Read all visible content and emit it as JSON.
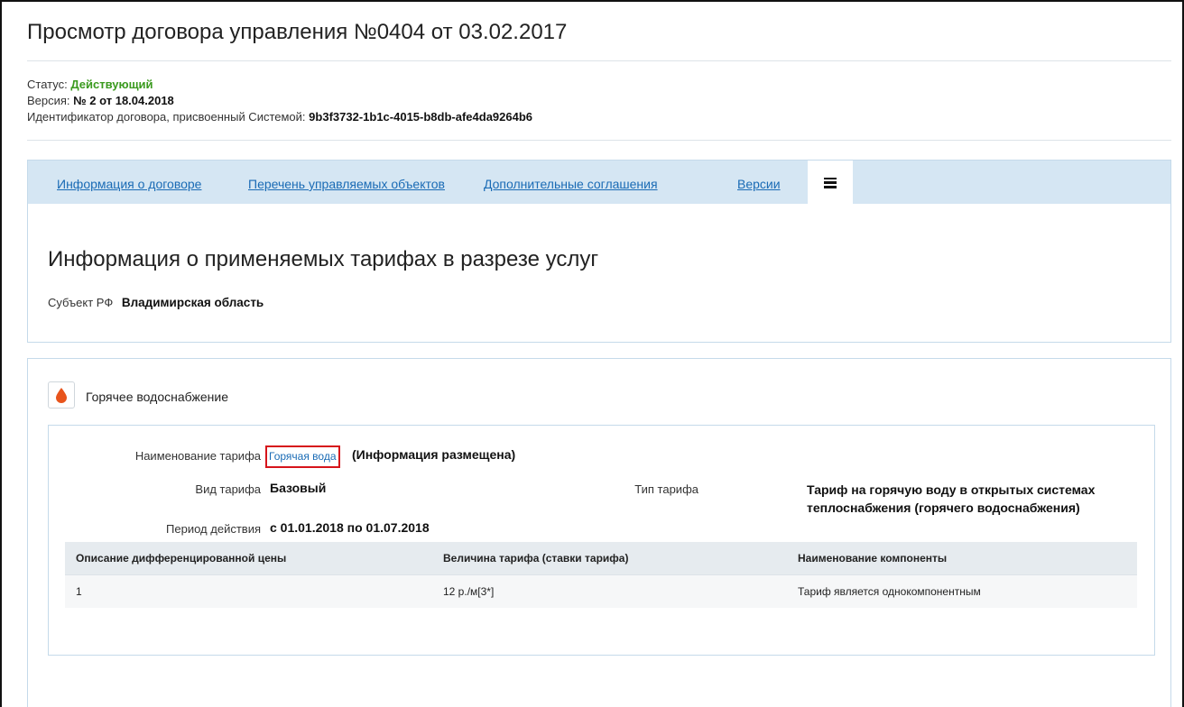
{
  "page": {
    "title": "Просмотр договора управления №0404 от 03.02.2017"
  },
  "meta": {
    "status_label": "Статус:",
    "status_value": "Действующий",
    "version_label": "Версия:",
    "version_value": "№ 2 от 18.04.2018",
    "id_label": "Идентификатор договора, присвоенный Системой:",
    "id_value": "9b3f3732-1b1c-4015-b8db-afe4da9264b6"
  },
  "tabs": [
    {
      "label": "Информация о договоре"
    },
    {
      "label": "Перечень управляемых объектов"
    },
    {
      "label": "Дополнительные соглашения"
    },
    {
      "label": "Версии"
    }
  ],
  "tariffs": {
    "section_title": "Информация о применяемых тарифах в разрезе услуг",
    "subject_label": "Субъект РФ",
    "subject_value": "Владимирская область"
  },
  "service": {
    "name": "Горячее водоснабжение",
    "icon": "water-drop-icon",
    "tariff_name_label": "Наименование тарифа",
    "tariff_name_link": "Горячая вода",
    "tariff_name_status": "(Информация размещена)",
    "tariff_kind_label": "Вид тарифа",
    "tariff_kind_value": "Базовый",
    "tariff_type_label": "Тип тарифа",
    "tariff_type_value_line1": "Тариф на горячую воду в открытых системах",
    "tariff_type_value_line2": "теплоснабжения (горячего водоснабжения)",
    "period_label": "Период действия",
    "period_value": "с 01.01.2018 по 01.07.2018",
    "table": {
      "headers": [
        "Описание дифференцированной цены",
        "Величина тарифа (ставки тарифа)",
        "Наименование компоненты"
      ],
      "rows": [
        [
          "1",
          "12 р./м[3*]",
          "Тариф является однокомпонентным"
        ]
      ]
    }
  },
  "colors": {
    "link": "#1a6bb5",
    "status_green": "#3a9a1e",
    "tab_bar": "#d5e6f3",
    "highlight_box": "#d6141b",
    "drop_icon": "#e8541c"
  }
}
